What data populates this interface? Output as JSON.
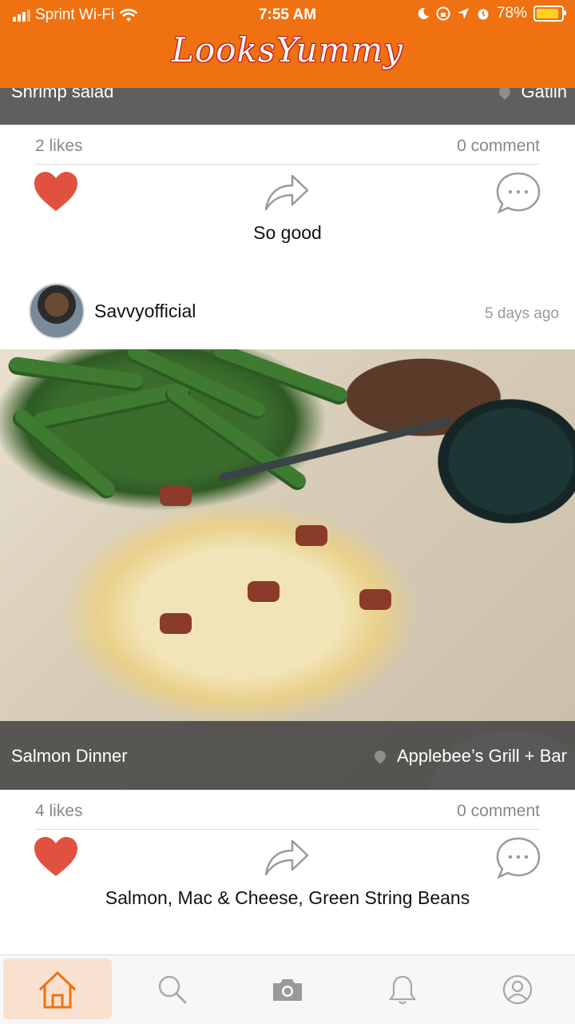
{
  "status_bar": {
    "carrier": "Sprint Wi-Fi",
    "time": "7:55 AM",
    "battery": "78%",
    "battery_level": 0.78
  },
  "app": {
    "logo_text": "LooksYummy"
  },
  "previous_post": {
    "title": "Shrimp salad",
    "location": "Gatlin",
    "likes": "2 likes",
    "comments": "0 comment",
    "description": "So good"
  },
  "post": {
    "username": "Savvyofficial",
    "time_ago": "5 days ago",
    "title": "Salmon Dinner",
    "location": "Applebee’s Grill + Bar",
    "likes": "4 likes",
    "comments": "0 comment",
    "description": "Salmon, Mac & Cheese, Green String Beans"
  },
  "bottom_nav": {
    "items": [
      {
        "icon": "home-icon",
        "active": true
      },
      {
        "icon": "search-icon",
        "active": false
      },
      {
        "icon": "camera-icon",
        "active": false
      },
      {
        "icon": "bell-icon",
        "active": false
      },
      {
        "icon": "profile-icon",
        "active": false
      }
    ]
  },
  "colors": {
    "brand": "#ef7112",
    "heart": "#e0523f",
    "active_tab_bg": "#f9e1d0"
  }
}
